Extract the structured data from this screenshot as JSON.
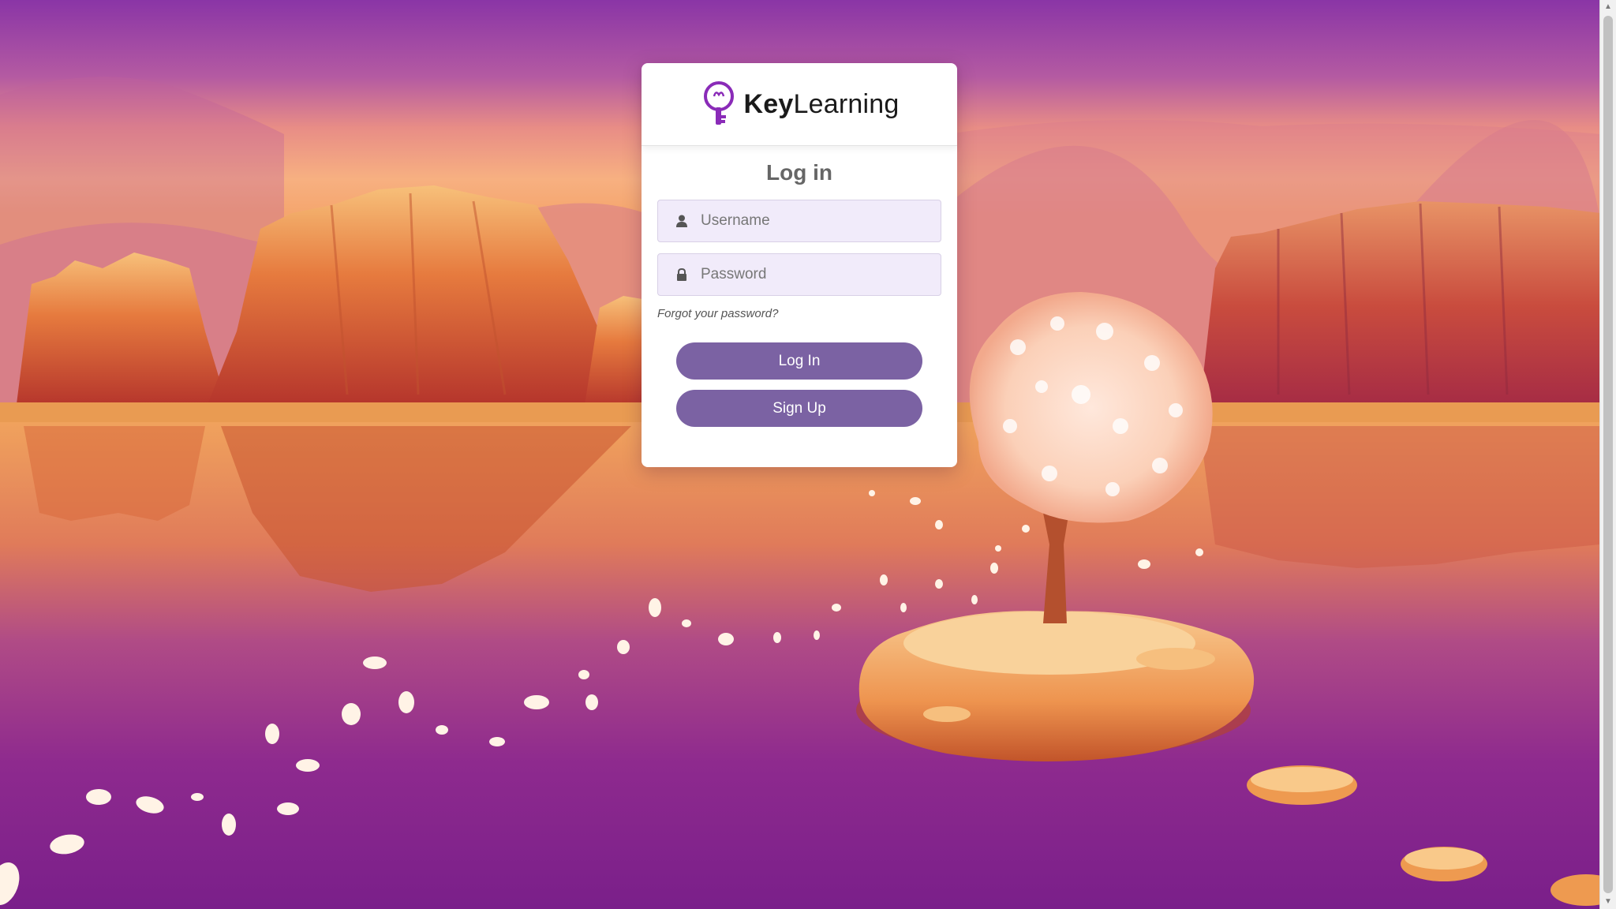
{
  "brand": {
    "bold": "Key",
    "rest": "Learning"
  },
  "login": {
    "title": "Log in",
    "username_placeholder": "Username",
    "password_placeholder": "Password",
    "forgot_link": "Forgot your password?",
    "login_button": "Log In",
    "signup_button": "Sign Up"
  },
  "icons": {
    "username": "user-icon",
    "password": "lock-icon",
    "logo": "key-bulb-logo-icon"
  },
  "colors": {
    "button": "#7b62a3",
    "field_bg": "#f1ebfa",
    "logo_purple": "#8a2bb8"
  }
}
